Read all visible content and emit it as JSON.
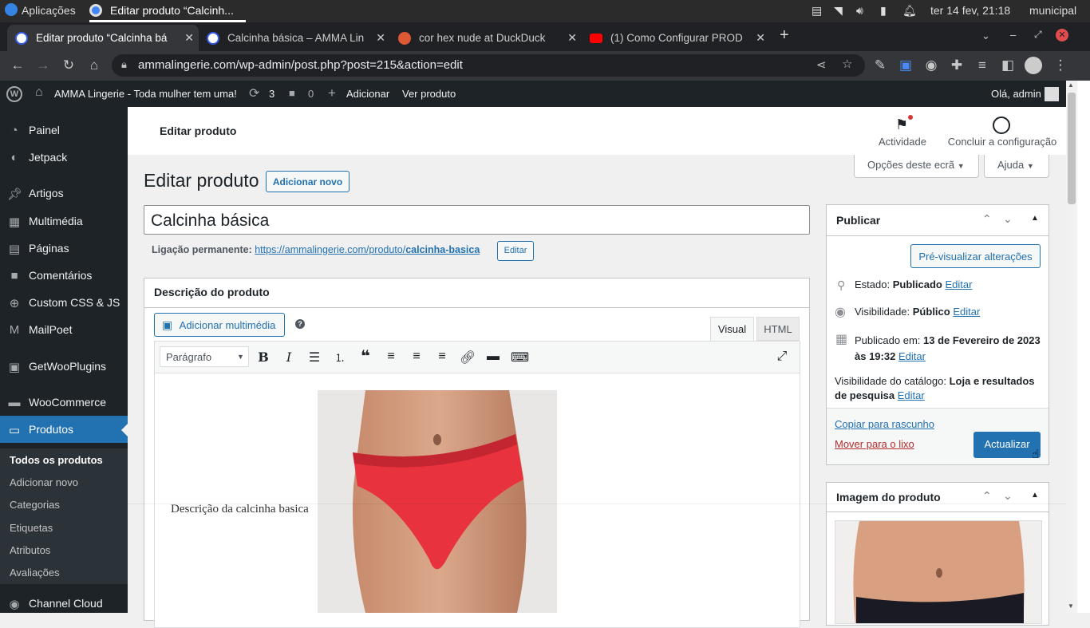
{
  "os": {
    "apps_label": "Aplicações",
    "active_window": "Editar produto “Calcinh...",
    "datetime": "ter 14 fev, 21:18",
    "location": "municipal"
  },
  "browser": {
    "tabs": [
      {
        "title": "Editar produto “Calcinha bá",
        "active": true
      },
      {
        "title": "Calcinha básica – AMMA Lin",
        "active": false
      },
      {
        "title": "cor hex nude at DuckDuck",
        "active": false
      },
      {
        "title": "(1) Como Configurar PROD",
        "active": false
      }
    ],
    "new_tab": "+",
    "url": "ammalingerie.com/wp-admin/post.php?post=215&action=edit"
  },
  "adminbar": {
    "site_name": "AMMA Lingerie - Toda mulher tem uma!",
    "updates_count": "3",
    "comments_count": "0",
    "add_new": "Adicionar",
    "view_product": "Ver produto",
    "greeting": "Olá, admin"
  },
  "sidebar": {
    "items": [
      {
        "label": "Painel",
        "icon": "dashboard-icon"
      },
      {
        "label": "Jetpack",
        "icon": "jetpack-icon"
      },
      {
        "label": "Artigos",
        "icon": "pin-icon"
      },
      {
        "label": "Multimédia",
        "icon": "media-icon"
      },
      {
        "label": "Páginas",
        "icon": "pages-icon"
      },
      {
        "label": "Comentários",
        "icon": "comments-icon"
      },
      {
        "label": "Custom CSS & JS",
        "icon": "plus-circle-icon"
      },
      {
        "label": "MailPoet",
        "icon": "mailpoet-icon"
      },
      {
        "label": "GetWooPlugins",
        "icon": "plugin-icon"
      },
      {
        "label": "WooCommerce",
        "icon": "woo-icon"
      },
      {
        "label": "Produtos",
        "icon": "products-icon"
      },
      {
        "label": "Channel Cloud",
        "icon": "cloud-icon"
      }
    ],
    "submenu": [
      "Todos os produtos",
      "Adicionar novo",
      "Categorias",
      "Etiquetas",
      "Atributos",
      "Avaliações"
    ]
  },
  "header": {
    "title": "Editar produto",
    "activity": "Actividade",
    "setup": "Concluir a configuração"
  },
  "screen_options": "Opções deste ecrã",
  "help": "Ajuda",
  "page": {
    "heading": "Editar produto",
    "add_new": "Adicionar novo",
    "product_title": "Calcinha básica",
    "permalink_label": "Ligação permanente:",
    "permalink_base": "https://ammalingerie.com/produto/",
    "permalink_slug": "calcinha-basica",
    "permalink_edit": "Editar"
  },
  "description": {
    "box_title": "Descrição do produto",
    "add_media": "Adicionar multimédia",
    "help_mark": "?",
    "tab_visual": "Visual",
    "tab_html": "HTML",
    "format": "Parágrafo",
    "content_text": "Descrição da calcinha basica"
  },
  "publish": {
    "title": "Publicar",
    "preview": "Pré-visualizar alterações",
    "status_label": "Estado:",
    "status_value": "Publicado",
    "visibility_label": "Visibilidade:",
    "visibility_value": "Público",
    "published_label": "Publicado em:",
    "published_value": "13 de Fevereiro de 2023 às 19:32",
    "catalog_label": "Visibilidade do catálogo:",
    "catalog_value": "Loja e resultados de pesquisa",
    "edit": "Editar",
    "copy_draft": "Copiar para rascunho",
    "trash": "Mover para o lixo",
    "update": "Actualizar"
  },
  "product_image": {
    "title": "Imagem do produto"
  },
  "colors": {
    "wp_blue": "#2271b1",
    "admin_dark": "#1d2327",
    "trash_red": "#b32d2e",
    "panty_red": "#e8333f"
  }
}
